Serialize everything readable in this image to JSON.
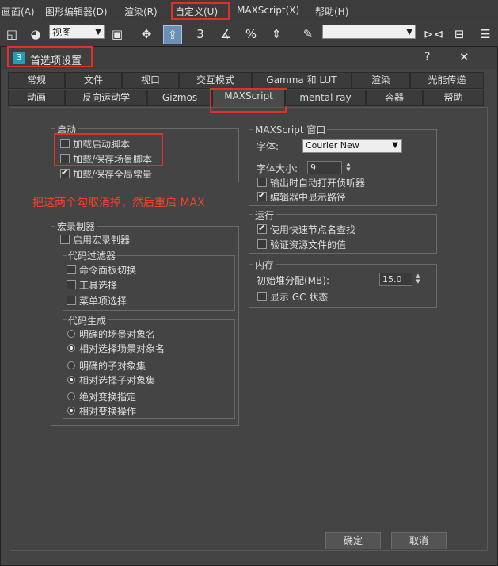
{
  "menubar": {
    "items": [
      "画面(A)",
      "图形编辑器(D)",
      "渲染(R)",
      "自定义(U)",
      "MAXScript(X)",
      "帮助(H)"
    ]
  },
  "toolbar": {
    "view_select": "视图",
    "snap_label": "3",
    "percent_label": "%"
  },
  "dialog": {
    "title": "首选项设置",
    "help_button": "?",
    "close_button": "✕"
  },
  "tabs": {
    "row1": [
      "常规",
      "文件",
      "视口",
      "交互模式",
      "Gamma 和 LUT",
      "渲染",
      "光能传递"
    ],
    "row2": [
      "动画",
      "反向运动学",
      "Gizmos",
      "MAXScript",
      "mental ray",
      "容器",
      "帮助"
    ],
    "active": "MAXScript"
  },
  "startup": {
    "title": "启动",
    "load_startup_scripts": "加载启动脚本",
    "load_save_scene_scripts": "加载/保存场景脚本",
    "load_save_globals": "加载/保存全局常量"
  },
  "annotation": "把这两个勾取消掉，然后重启 MAX",
  "macro": {
    "title": "宏录制器",
    "enable": "启用宏录制器",
    "filter_title": "代码过滤器",
    "filter_items": [
      "命令面板切换",
      "工具选择",
      "菜单项选择"
    ],
    "gen_title": "代码生成",
    "gen_items": [
      "明确的场景对象名",
      "相对选择场景对象名",
      "明确的子对象集",
      "相对选择子对象集",
      "绝对变换指定",
      "相对变换操作"
    ]
  },
  "editor": {
    "title": "MAXScript 窗口",
    "font_label": "字体:",
    "font_value": "Courier New",
    "size_label": "字体大小:",
    "size_value": "9",
    "auto_open_listener": "输出时自动打开侦听器",
    "show_path": "编辑器中显示路径"
  },
  "run": {
    "title": "运行",
    "fast_node_lookup": "使用快速节点名查找",
    "verify_resource": "验证资源文件的值"
  },
  "memory": {
    "title": "内存",
    "heap_label": "初始堆分配(MB):",
    "heap_value": "15.0",
    "show_gc": "显示 GC 状态"
  },
  "buttons": {
    "ok": "确定",
    "cancel": "取消"
  },
  "colors": {
    "highlight": "#e0302a",
    "background": "#444444"
  }
}
